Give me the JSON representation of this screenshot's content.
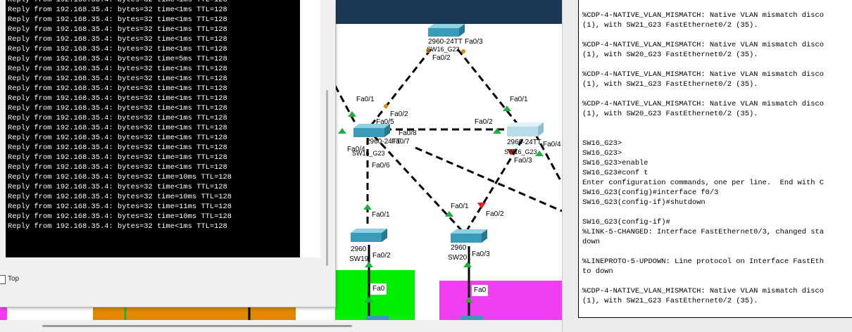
{
  "command_prompt": {
    "lines": [
      "Reply from 192.168.35.4: bytes=32 time<1ms TTL=128",
      "Reply from 192.168.35.4: bytes=32 time<1ms TTL=128",
      "Reply from 192.168.35.4: bytes=32 time<1ms TTL=128",
      "Reply from 192.168.35.4: bytes=32 time<1ms TTL=128",
      "Reply from 192.168.35.4: bytes=32 time<1ms TTL=128",
      "Reply from 192.168.35.4: bytes=32 time<1ms TTL=128",
      "Reply from 192.168.35.4: bytes=32 time=5ms TTL=128",
      "Reply from 192.168.35.4: bytes=32 time<1ms TTL=128",
      "Reply from 192.168.35.4: bytes=32 time<1ms TTL=128",
      "Reply from 192.168.35.4: bytes=32 time<1ms TTL=128",
      "Reply from 192.168.35.4: bytes=32 time<1ms TTL=128",
      "Reply from 192.168.35.4: bytes=32 time<1ms TTL=128",
      "Reply from 192.168.35.4: bytes=32 time<1ms TTL=128",
      "Reply from 192.168.35.4: bytes=32 time<1ms TTL=128",
      "Reply from 192.168.35.4: bytes=32 time<1ms TTL=128",
      "Reply from 192.168.35.4: bytes=32 time<1ms TTL=128",
      "Reply from 192.168.35.4: bytes=32 time=1ms TTL=128",
      "Reply from 192.168.35.4: bytes=32 time<1ms TTL=128",
      "Reply from 192.168.35.4: bytes=32 time=10ms TTL=128",
      "Reply from 192.168.35.4: bytes=32 time<1ms TTL=128",
      "Reply from 192.168.35.4: bytes=32 time=10ms TTL=128",
      "Reply from 192.168.35.4: bytes=32 time=11ms TTL=128",
      "Reply from 192.168.35.4: bytes=32 time=10ms TTL=128",
      "Reply from 192.168.35.4: bytes=32 time<1ms TTL=128"
    ],
    "top_checkbox_label": "Top"
  },
  "topology": {
    "labels": {
      "sw_top_model": "2960-24TT",
      "sw_top_name": "SW16_G23",
      "sw_top_fa03": "Fa0/3",
      "sw_top_fa02": "Fa0/2",
      "sw_top_left_fa01": "Fa0/1",
      "sw_top_right_fa01": "Fa0/1",
      "sw_left_fa02": "Fa0/2",
      "sw_left_fa05": "Fa0/5",
      "sw_left_fa08": "Fa0/8",
      "sw_left_fa07": "Fa0/7",
      "sw_left_fa04": "Fa0/4",
      "sw_left_model": "2960-24TT",
      "sw_left_name": "SW16_G23",
      "sw_left_fa06": "Fa0/6",
      "sw_right_fa02": "Fa0/2",
      "sw_right_model": "2960-24TT",
      "sw_right_name": "SW16_G23",
      "sw_right_fa04": "Fa0/4",
      "sw_right_fa03": "Fa0/3",
      "sw19_fa01": "Fa0/1",
      "sw19_model": "2960",
      "sw19_name": "SW19",
      "sw19_fa02": "Fa0/2",
      "sw20_fa01": "Fa0/1",
      "sw20_fa02": "Fa0/2",
      "sw20_model": "2960",
      "sw20_name": "SW20",
      "sw20_fa03": "Fa0/3",
      "green_fa0": "Fa0",
      "magenta_fa0": "Fa0"
    },
    "colors": {
      "header": "#1c3857",
      "switch": "#3a9bb8",
      "green_area": "#00ee00",
      "magenta_area": "#f23ef2",
      "orange_area": "#df8a00",
      "link_up": "#20b040",
      "link_down": "#e02020"
    }
  },
  "cli": {
    "lines": [
      "%CDP-4-NATIVE_VLAN_MISMATCH: Native VLAN mismatch disco",
      "(1), with SW21_G23 FastEthernet0/2 (35).",
      "",
      "%CDP-4-NATIVE_VLAN_MISMATCH: Native VLAN mismatch disco",
      "(1), with SW20_G23 FastEthernet0/2 (35).",
      "",
      "%CDP-4-NATIVE_VLAN_MISMATCH: Native VLAN mismatch disco",
      "(1), with SW21_G23 FastEthernet0/2 (35).",
      "",
      "%CDP-4-NATIVE_VLAN_MISMATCH: Native VLAN mismatch disco",
      "(1), with SW20_G23 FastEthernet0/2 (35).",
      "",
      "",
      "SW16_G23>",
      "SW16_G23>",
      "SW16_G23>enable",
      "SW16_G23#conf t",
      "Enter configuration commands, one per line.  End with C",
      "SW16_G23(config)#interface f0/3",
      "SW16_G23(config-if)#shutdown",
      "",
      "SW16_G23(config-if)#",
      "%LINK-5-CHANGED: Interface FastEthernet0/3, changed sta",
      "down",
      "",
      "%LINEPROTO-5-UPDOWN: Line protocol on Interface FastEth",
      "to down",
      "",
      "%CDP-4-NATIVE_VLAN_MISMATCH: Native VLAN mismatch disco",
      "(1), with SW21_G23 FastEthernet0/2 (35)."
    ]
  }
}
